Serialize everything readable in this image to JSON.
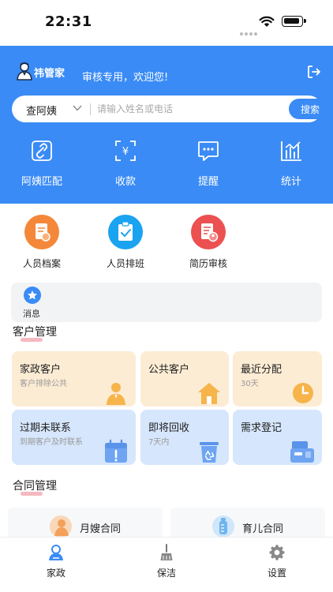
{
  "status_bar": {
    "time": "22:31"
  },
  "header": {
    "brand_name": "祎管家",
    "greeting": "审核专用，欢迎您!",
    "search": {
      "type_label": "查阿姨",
      "placeholder": "请输入姓名或电话",
      "button_label": "搜索"
    },
    "quick_actions": [
      {
        "label": "阿姨匹配",
        "icon": "link-icon"
      },
      {
        "label": "收款",
        "icon": "yuan-scan-icon"
      },
      {
        "label": "提醒",
        "icon": "chat-bubble-icon"
      },
      {
        "label": "统计",
        "icon": "bar-chart-icon"
      }
    ],
    "colors": {
      "primary": "#3a8bf5"
    }
  },
  "menu": [
    {
      "label": "人员档案",
      "icon": "profile-file-icon",
      "color": "#f4873a"
    },
    {
      "label": "人员排班",
      "icon": "clipboard-check-icon",
      "color": "#1aa3f0"
    },
    {
      "label": "简历审核",
      "icon": "resume-user-icon",
      "color": "#ec5050"
    }
  ],
  "messages": {
    "label": "消息",
    "icon": "star-icon"
  },
  "customer_section": {
    "title": "客户管理",
    "cards": [
      {
        "title": "家政客户",
        "subtitle": "客户排除公共",
        "icon": "person-icon"
      },
      {
        "title": "公共客户",
        "subtitle": "",
        "icon": "house-icon"
      },
      {
        "title": "最近分配",
        "subtitle": "30天",
        "icon": "clock-icon"
      },
      {
        "title": "过期未联系",
        "subtitle": "到期客户及时联系",
        "icon": "calendar-alert-icon"
      },
      {
        "title": "即将回收",
        "subtitle": "7天内",
        "icon": "recycle-bin-icon"
      },
      {
        "title": "需求登记",
        "subtitle": "",
        "icon": "register-machine-icon"
      }
    ]
  },
  "contract_section": {
    "title": "合同管理",
    "items": [
      {
        "label": "月嫂合同",
        "icon": "nanny-icon"
      },
      {
        "label": "育儿合同",
        "icon": "baby-bottle-icon"
      }
    ]
  },
  "tab_bar": [
    {
      "label": "家政",
      "icon": "housekeeping-icon",
      "active": true
    },
    {
      "label": "保洁",
      "icon": "broom-icon",
      "active": false
    },
    {
      "label": "设置",
      "icon": "gear-icon",
      "active": false
    }
  ]
}
